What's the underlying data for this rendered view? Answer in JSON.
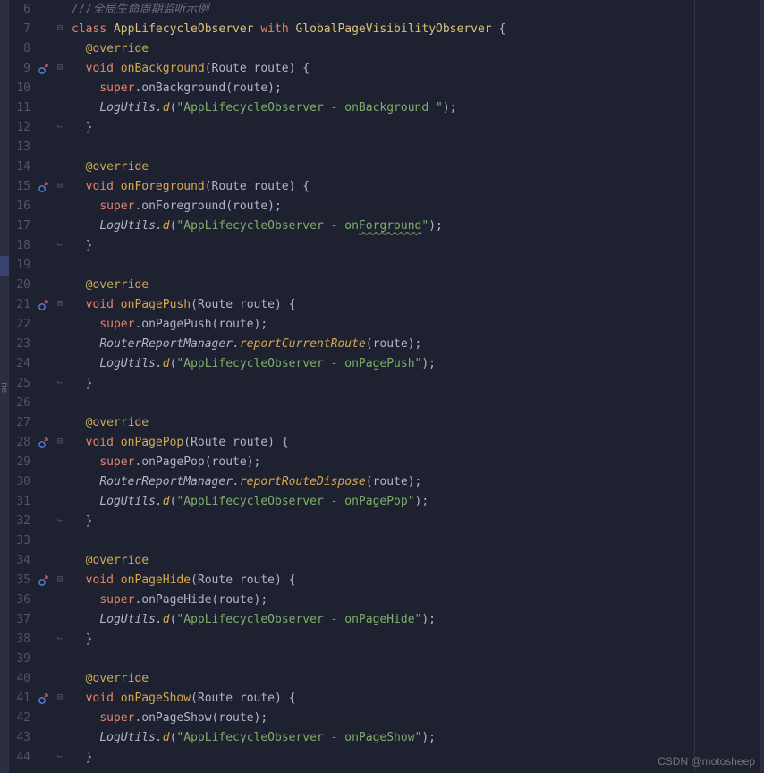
{
  "watermark": "CSDN @motosheep",
  "left_tab": "ne",
  "line_highlight_row": 19,
  "lines": [
    {
      "num": 6,
      "badge": null,
      "fold": "",
      "tokens": [
        {
          "c": "comment",
          "t": "///全局生命周期监听示例"
        }
      ]
    },
    {
      "num": 7,
      "badge": null,
      "fold": "open",
      "tokens": [
        {
          "c": "kw",
          "t": "class "
        },
        {
          "c": "type",
          "t": "AppLifecycleObserver "
        },
        {
          "c": "kw",
          "t": "with "
        },
        {
          "c": "type",
          "t": "GlobalPageVisibilityObserver "
        },
        {
          "c": "punct",
          "t": "{"
        }
      ]
    },
    {
      "num": 8,
      "badge": null,
      "fold": "",
      "indent": 1,
      "tokens": [
        {
          "c": "decorator",
          "t": "@override"
        }
      ]
    },
    {
      "num": 9,
      "badge": "override",
      "fold": "open",
      "indent": 1,
      "tokens": [
        {
          "c": "kw",
          "t": "void "
        },
        {
          "c": "method",
          "t": "onBackground"
        },
        {
          "c": "punct",
          "t": "(Route route) {"
        }
      ]
    },
    {
      "num": 10,
      "badge": null,
      "fold": "",
      "indent": 2,
      "tokens": [
        {
          "c": "super",
          "t": "super"
        },
        {
          "c": "punct",
          "t": ".onBackground("
        },
        {
          "c": "param",
          "t": "route"
        },
        {
          "c": "punct",
          "t": ");"
        }
      ]
    },
    {
      "num": 11,
      "badge": null,
      "fold": "",
      "indent": 2,
      "tokens": [
        {
          "c": "static-call",
          "t": "LogUtils."
        },
        {
          "c": "static-method",
          "t": "d"
        },
        {
          "c": "punct",
          "t": "("
        },
        {
          "c": "str",
          "t": "\"AppLifecycleObserver - onBackground \""
        },
        {
          "c": "punct",
          "t": ");"
        }
      ]
    },
    {
      "num": 12,
      "badge": null,
      "fold": "close",
      "indent": 1,
      "tokens": [
        {
          "c": "punct",
          "t": "}"
        }
      ]
    },
    {
      "num": 13,
      "badge": null,
      "fold": "",
      "tokens": []
    },
    {
      "num": 14,
      "badge": null,
      "fold": "",
      "indent": 1,
      "tokens": [
        {
          "c": "decorator",
          "t": "@override"
        }
      ]
    },
    {
      "num": 15,
      "badge": "override",
      "fold": "open",
      "indent": 1,
      "tokens": [
        {
          "c": "kw",
          "t": "void "
        },
        {
          "c": "method",
          "t": "onForeground"
        },
        {
          "c": "punct",
          "t": "(Route route) {"
        }
      ]
    },
    {
      "num": 16,
      "badge": null,
      "fold": "",
      "indent": 2,
      "tokens": [
        {
          "c": "super",
          "t": "super"
        },
        {
          "c": "punct",
          "t": ".onForeground("
        },
        {
          "c": "param",
          "t": "route"
        },
        {
          "c": "punct",
          "t": ");"
        }
      ]
    },
    {
      "num": 17,
      "badge": null,
      "fold": "",
      "indent": 2,
      "tokens": [
        {
          "c": "static-call",
          "t": "LogUtils."
        },
        {
          "c": "static-method",
          "t": "d"
        },
        {
          "c": "punct",
          "t": "("
        },
        {
          "c": "str",
          "t": "\"AppLifecycleObserver - on"
        },
        {
          "c": "str warn-underline",
          "t": "Forground"
        },
        {
          "c": "str",
          "t": "\""
        },
        {
          "c": "punct",
          "t": ");"
        }
      ]
    },
    {
      "num": 18,
      "badge": null,
      "fold": "close",
      "indent": 1,
      "tokens": [
        {
          "c": "punct",
          "t": "}"
        }
      ]
    },
    {
      "num": 19,
      "badge": null,
      "fold": "",
      "tokens": []
    },
    {
      "num": 20,
      "badge": null,
      "fold": "",
      "indent": 1,
      "tokens": [
        {
          "c": "decorator",
          "t": "@override"
        }
      ]
    },
    {
      "num": 21,
      "badge": "override",
      "fold": "open",
      "indent": 1,
      "tokens": [
        {
          "c": "kw",
          "t": "void "
        },
        {
          "c": "method",
          "t": "onPagePush"
        },
        {
          "c": "punct",
          "t": "(Route route) {"
        }
      ]
    },
    {
      "num": 22,
      "badge": null,
      "fold": "",
      "indent": 2,
      "tokens": [
        {
          "c": "super",
          "t": "super"
        },
        {
          "c": "punct",
          "t": ".onPagePush("
        },
        {
          "c": "param",
          "t": "route"
        },
        {
          "c": "punct",
          "t": ");"
        }
      ]
    },
    {
      "num": 23,
      "badge": null,
      "fold": "",
      "indent": 2,
      "tokens": [
        {
          "c": "static-call",
          "t": "RouterReportManager."
        },
        {
          "c": "static-method",
          "t": "reportCurrentRoute"
        },
        {
          "c": "punct",
          "t": "("
        },
        {
          "c": "param",
          "t": "route"
        },
        {
          "c": "punct",
          "t": ");"
        }
      ]
    },
    {
      "num": 24,
      "badge": null,
      "fold": "",
      "indent": 2,
      "tokens": [
        {
          "c": "static-call",
          "t": "LogUtils."
        },
        {
          "c": "static-method",
          "t": "d"
        },
        {
          "c": "punct",
          "t": "("
        },
        {
          "c": "str",
          "t": "\"AppLifecycleObserver - onPagePush\""
        },
        {
          "c": "punct",
          "t": ");"
        }
      ]
    },
    {
      "num": 25,
      "badge": null,
      "fold": "close",
      "indent": 1,
      "tokens": [
        {
          "c": "punct",
          "t": "}"
        }
      ]
    },
    {
      "num": 26,
      "badge": null,
      "fold": "",
      "tokens": []
    },
    {
      "num": 27,
      "badge": null,
      "fold": "",
      "indent": 1,
      "tokens": [
        {
          "c": "decorator",
          "t": "@override"
        }
      ]
    },
    {
      "num": 28,
      "badge": "override",
      "fold": "open",
      "indent": 1,
      "tokens": [
        {
          "c": "kw",
          "t": "void "
        },
        {
          "c": "method",
          "t": "onPagePop"
        },
        {
          "c": "punct",
          "t": "(Route route) {"
        }
      ]
    },
    {
      "num": 29,
      "badge": null,
      "fold": "",
      "indent": 2,
      "tokens": [
        {
          "c": "super",
          "t": "super"
        },
        {
          "c": "punct",
          "t": ".onPagePop("
        },
        {
          "c": "param",
          "t": "route"
        },
        {
          "c": "punct",
          "t": ");"
        }
      ]
    },
    {
      "num": 30,
      "badge": null,
      "fold": "",
      "indent": 2,
      "tokens": [
        {
          "c": "static-call",
          "t": "RouterReportManager."
        },
        {
          "c": "static-method",
          "t": "reportRouteDispose"
        },
        {
          "c": "punct",
          "t": "("
        },
        {
          "c": "param",
          "t": "route"
        },
        {
          "c": "punct",
          "t": ");"
        }
      ]
    },
    {
      "num": 31,
      "badge": null,
      "fold": "",
      "indent": 2,
      "tokens": [
        {
          "c": "static-call",
          "t": "LogUtils."
        },
        {
          "c": "static-method",
          "t": "d"
        },
        {
          "c": "punct",
          "t": "("
        },
        {
          "c": "str",
          "t": "\"AppLifecycleObserver - onPagePop\""
        },
        {
          "c": "punct",
          "t": ");"
        }
      ]
    },
    {
      "num": 32,
      "badge": null,
      "fold": "close",
      "indent": 1,
      "tokens": [
        {
          "c": "punct",
          "t": "}"
        }
      ]
    },
    {
      "num": 33,
      "badge": null,
      "fold": "",
      "tokens": []
    },
    {
      "num": 34,
      "badge": null,
      "fold": "",
      "indent": 1,
      "tokens": [
        {
          "c": "decorator",
          "t": "@override"
        }
      ]
    },
    {
      "num": 35,
      "badge": "override",
      "fold": "open",
      "indent": 1,
      "tokens": [
        {
          "c": "kw",
          "t": "void "
        },
        {
          "c": "method",
          "t": "onPageHide"
        },
        {
          "c": "punct",
          "t": "(Route route) {"
        }
      ]
    },
    {
      "num": 36,
      "badge": null,
      "fold": "",
      "indent": 2,
      "tokens": [
        {
          "c": "super",
          "t": "super"
        },
        {
          "c": "punct",
          "t": ".onPageHide("
        },
        {
          "c": "param",
          "t": "route"
        },
        {
          "c": "punct",
          "t": ");"
        }
      ]
    },
    {
      "num": 37,
      "badge": null,
      "fold": "",
      "indent": 2,
      "tokens": [
        {
          "c": "static-call",
          "t": "LogUtils."
        },
        {
          "c": "static-method",
          "t": "d"
        },
        {
          "c": "punct",
          "t": "("
        },
        {
          "c": "str",
          "t": "\"AppLifecycleObserver - onPageHide\""
        },
        {
          "c": "punct",
          "t": ");"
        }
      ]
    },
    {
      "num": 38,
      "badge": null,
      "fold": "close",
      "indent": 1,
      "tokens": [
        {
          "c": "punct",
          "t": "}"
        }
      ]
    },
    {
      "num": 39,
      "badge": null,
      "fold": "",
      "tokens": []
    },
    {
      "num": 40,
      "badge": null,
      "fold": "",
      "indent": 1,
      "tokens": [
        {
          "c": "decorator",
          "t": "@override"
        }
      ]
    },
    {
      "num": 41,
      "badge": "override",
      "fold": "open",
      "indent": 1,
      "tokens": [
        {
          "c": "kw",
          "t": "void "
        },
        {
          "c": "method",
          "t": "onPageShow"
        },
        {
          "c": "punct",
          "t": "(Route route) {"
        }
      ]
    },
    {
      "num": 42,
      "badge": null,
      "fold": "",
      "indent": 2,
      "tokens": [
        {
          "c": "super",
          "t": "super"
        },
        {
          "c": "punct",
          "t": ".onPageShow("
        },
        {
          "c": "param",
          "t": "route"
        },
        {
          "c": "punct",
          "t": ");"
        }
      ]
    },
    {
      "num": 43,
      "badge": null,
      "fold": "",
      "indent": 2,
      "tokens": [
        {
          "c": "static-call",
          "t": "LogUtils."
        },
        {
          "c": "static-method",
          "t": "d"
        },
        {
          "c": "punct",
          "t": "("
        },
        {
          "c": "str",
          "t": "\"AppLifecycleObserver - onPageShow\""
        },
        {
          "c": "punct",
          "t": ");"
        }
      ]
    },
    {
      "num": 44,
      "badge": null,
      "fold": "close",
      "indent": 1,
      "tokens": [
        {
          "c": "punct",
          "t": "}"
        }
      ]
    }
  ]
}
